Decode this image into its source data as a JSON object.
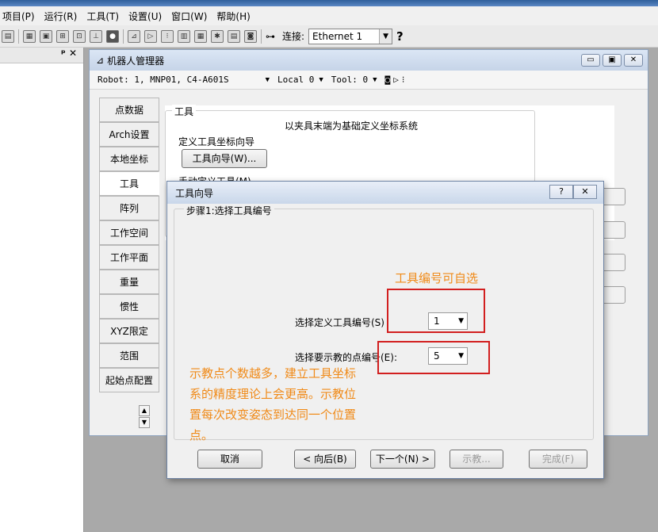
{
  "menubar": {
    "items": [
      "项目(P)",
      "运行(R)",
      "工具(T)",
      "设置(U)",
      "窗口(W)",
      "帮助(H)"
    ]
  },
  "toolbar": {
    "connection_label": "连接:",
    "connection_value": "Ethernet 1",
    "help_label": "?"
  },
  "left_panel": {
    "pin_close": "ᵖ ✕"
  },
  "robot_manager": {
    "title": "机器人管理器",
    "robot_label": "Robot: 1, MNP01, C4-A601S",
    "local_label": "Local 0",
    "tool_label": "Tool: 0",
    "tabs": [
      "点数据",
      "Arch设置",
      "本地坐标",
      "工具",
      "阵列",
      "工作空间",
      "工作平面",
      "重量",
      "惯性",
      "XYZ限定",
      "范围",
      "起始点配置"
    ],
    "active_tab": "工具",
    "tool_group_label": "工具",
    "tool_desc": "以夹具末端为基础定义坐标系统",
    "wizard_section": "定义工具坐标向导",
    "wizard_button": "工具向导(W)...",
    "manual_section": "手动定义工具(M)"
  },
  "dialog": {
    "title": "工具向导",
    "help_btn": "?",
    "close_btn": "✕",
    "step_label": "步骤1:选择工具编号",
    "tool_number_label": "选择定义工具编号(S)",
    "tool_number_value": "1",
    "point_count_label": "选择要示教的点编号(E):",
    "point_count_value": "5",
    "buttons": {
      "cancel": "取消",
      "back": "< 向后(B)",
      "next": "下一个(N) >",
      "teach": "示教...",
      "finish": "完成(F)"
    }
  },
  "annotations": {
    "note1": "工具编号可自选",
    "note2_lines": [
      "示教点个数越多，建立工具坐标",
      "系的精度理论上会更高。示教位",
      "置每次改变姿态到达同一个位置",
      "点。"
    ],
    "color": "#f08a18",
    "box_color": "#d21f1f"
  }
}
